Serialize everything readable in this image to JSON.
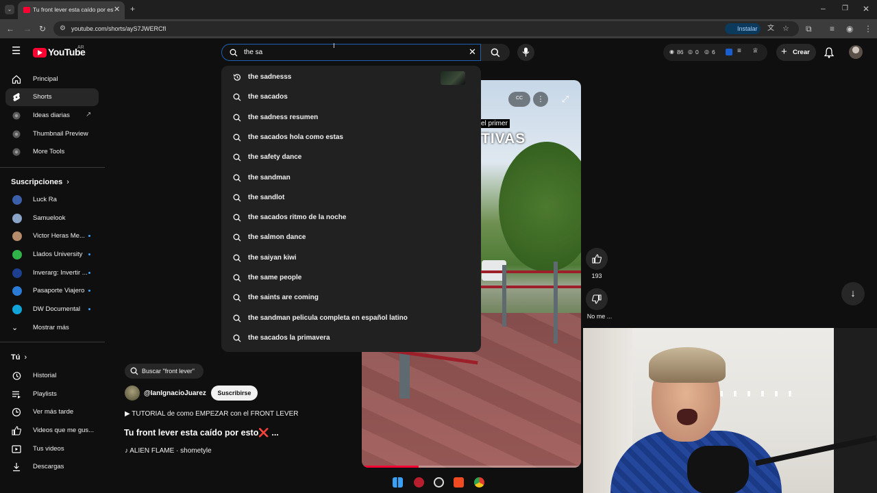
{
  "browser": {
    "tab_title": "Tu front lever esta caído por esto",
    "url": "youtube.com/shorts/ayS7JWERCfI",
    "install_label": "Instalar"
  },
  "header": {
    "logo_text": "YouTube",
    "logo_country": "AR",
    "search_value": "the sa",
    "stats": [
      "86",
      "0",
      "6"
    ],
    "create_label": "Crear"
  },
  "sidebar": {
    "main": [
      {
        "label": "Principal",
        "icon": "home-icon"
      },
      {
        "label": "Shorts",
        "icon": "shorts-icon",
        "active": true
      },
      {
        "label": "Ideas diarias",
        "icon": "extension-icon",
        "external": true
      },
      {
        "label": "Thumbnail Preview",
        "icon": "extension-icon"
      },
      {
        "label": "More Tools",
        "icon": "extension-icon"
      }
    ],
    "subs_title": "Suscripciones",
    "subscriptions": [
      {
        "label": "Luck Ra",
        "color": "#3b5fa8",
        "dot": false
      },
      {
        "label": "Samuelook",
        "color": "#8aa4c8",
        "dot": false
      },
      {
        "label": "Victor Heras Me...",
        "color": "#b58b6c",
        "dot": true
      },
      {
        "label": "Llados University",
        "color": "#2fb34a",
        "dot": true
      },
      {
        "label": "Inverarg: Invertir ...",
        "color": "#1d3f8f",
        "dot": true
      },
      {
        "label": "Pasaporte Viajero",
        "color": "#2a7ad6",
        "dot": true
      },
      {
        "label": "DW Documental",
        "color": "#10a4d8",
        "dot": true
      }
    ],
    "more_label": "Mostrar más",
    "you_title": "Tú",
    "you_items": [
      {
        "label": "Historial",
        "icon": "history-icon"
      },
      {
        "label": "Playlists",
        "icon": "playlist-icon"
      },
      {
        "label": "Ver más tarde",
        "icon": "clock-icon"
      },
      {
        "label": "Videos que me gus...",
        "icon": "like-icon"
      },
      {
        "label": "Tus videos",
        "icon": "video-icon"
      },
      {
        "label": "Descargas",
        "icon": "download-icon"
      }
    ]
  },
  "suggestions": [
    {
      "text": "the sadnesss",
      "history": true
    },
    {
      "text": "the sacados"
    },
    {
      "text": "the sadness resumen"
    },
    {
      "text": "the sacados hola como estas"
    },
    {
      "text": "the safety dance"
    },
    {
      "text": "the sandman"
    },
    {
      "text": "the sandlot"
    },
    {
      "text": "the sacados ritmo de la noche"
    },
    {
      "text": "the salmon dance"
    },
    {
      "text": "the saiyan kiwi"
    },
    {
      "text": "the same people"
    },
    {
      "text": "the saints are coming"
    },
    {
      "text": "the sandman pelicula completa en español latino"
    },
    {
      "text": "the sacados la primavera"
    }
  ],
  "video": {
    "caption": "el primer",
    "big_text": "TIVAS",
    "cc_label": "CC",
    "progress": 0.26
  },
  "actions": {
    "like_count": "193",
    "dislike_label": "No me ..."
  },
  "info": {
    "search_chip": "Buscar \"front lever\"",
    "channel": "@IanIgnacioJuarez",
    "subscribe": "Suscribirse",
    "description": "▶ TUTORIAL de como EMPEZAR con el FRONT LEVER",
    "title": "Tu front lever esta caído por esto❌ ...",
    "music": "♪ ALIEN FLAME · shometyle"
  }
}
